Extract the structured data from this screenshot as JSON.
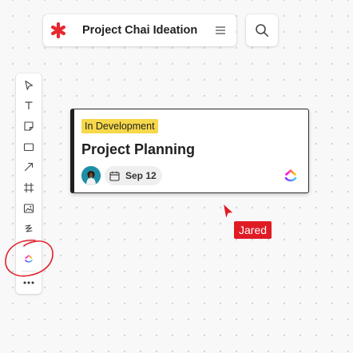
{
  "header": {
    "logo_icon": "asterisk-logo-icon",
    "board_title": "Project Chai Ideation",
    "menu_icon": "hamburger-menu-icon",
    "search_icon": "search-icon"
  },
  "toolbar": {
    "tools": [
      {
        "name": "select-tool",
        "icon": "pointer-arrow-icon"
      },
      {
        "name": "text-tool",
        "icon": "text-t-icon"
      },
      {
        "name": "sticky-note-tool",
        "icon": "sticky-note-icon"
      },
      {
        "name": "shape-tool",
        "icon": "rectangle-icon"
      },
      {
        "name": "connector-tool",
        "icon": "arrow-diagonal-icon"
      },
      {
        "name": "frame-tool",
        "icon": "frame-icon"
      },
      {
        "name": "image-tool",
        "icon": "image-icon"
      },
      {
        "name": "pen-tool",
        "icon": "pen-scribble-icon"
      },
      {
        "name": "clickup-tool",
        "icon": "clickup-logo-icon"
      },
      {
        "name": "more-tools",
        "icon": "ellipsis-icon"
      }
    ]
  },
  "card": {
    "status": "In Development",
    "title": "Project Planning",
    "due_date": "Sep 12",
    "assignee_icon": "avatar",
    "date_icon": "calendar-icon",
    "app_icon": "clickup-logo-icon"
  },
  "collaborator": {
    "name": "Jared",
    "color": "#e01b24"
  },
  "colors": {
    "accent_red": "#e01b24",
    "status_yellow": "#f6d84a",
    "canvas": "#f8f8f8"
  }
}
